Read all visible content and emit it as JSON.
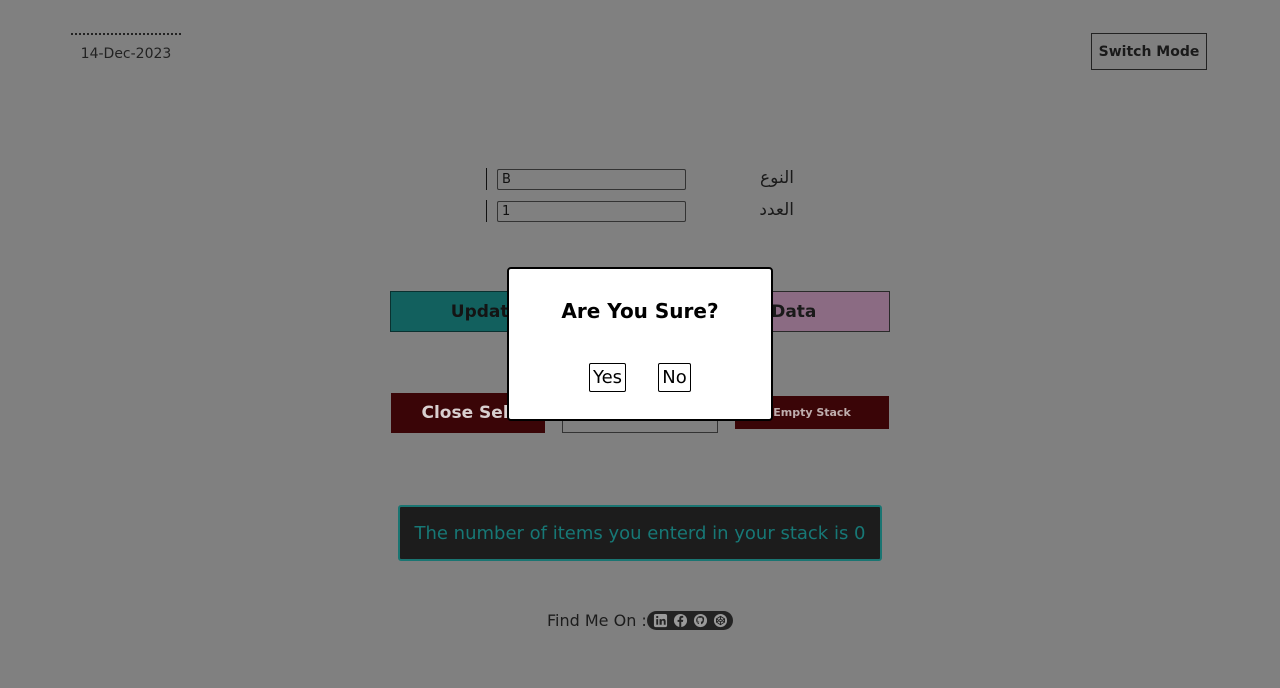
{
  "header": {
    "date": "14-Dec-2023",
    "switch_label": "Switch Mode"
  },
  "form": {
    "type_label": "النوع",
    "type_value": "B",
    "count_label": "العدد",
    "count_value": "1"
  },
  "actions": {
    "update_label": "Update Stack",
    "show_label": "Show Data",
    "close_label": "Close Sell",
    "empty_label": "Empty Stack"
  },
  "status": {
    "message": "The number of items you enterd in your stack is 0"
  },
  "footer": {
    "find_label": "Find Me On :",
    "icons": [
      "linkedin-icon",
      "facebook-icon",
      "github-icon",
      "codepen-icon"
    ]
  },
  "modal": {
    "title": "Are You Sure?",
    "yes_label": "Yes",
    "no_label": "No"
  },
  "colors": {
    "background": "#808080",
    "teal": "#12605e",
    "mauve": "#8b6b83",
    "maroon": "#3a0507",
    "status_text": "#177876"
  }
}
